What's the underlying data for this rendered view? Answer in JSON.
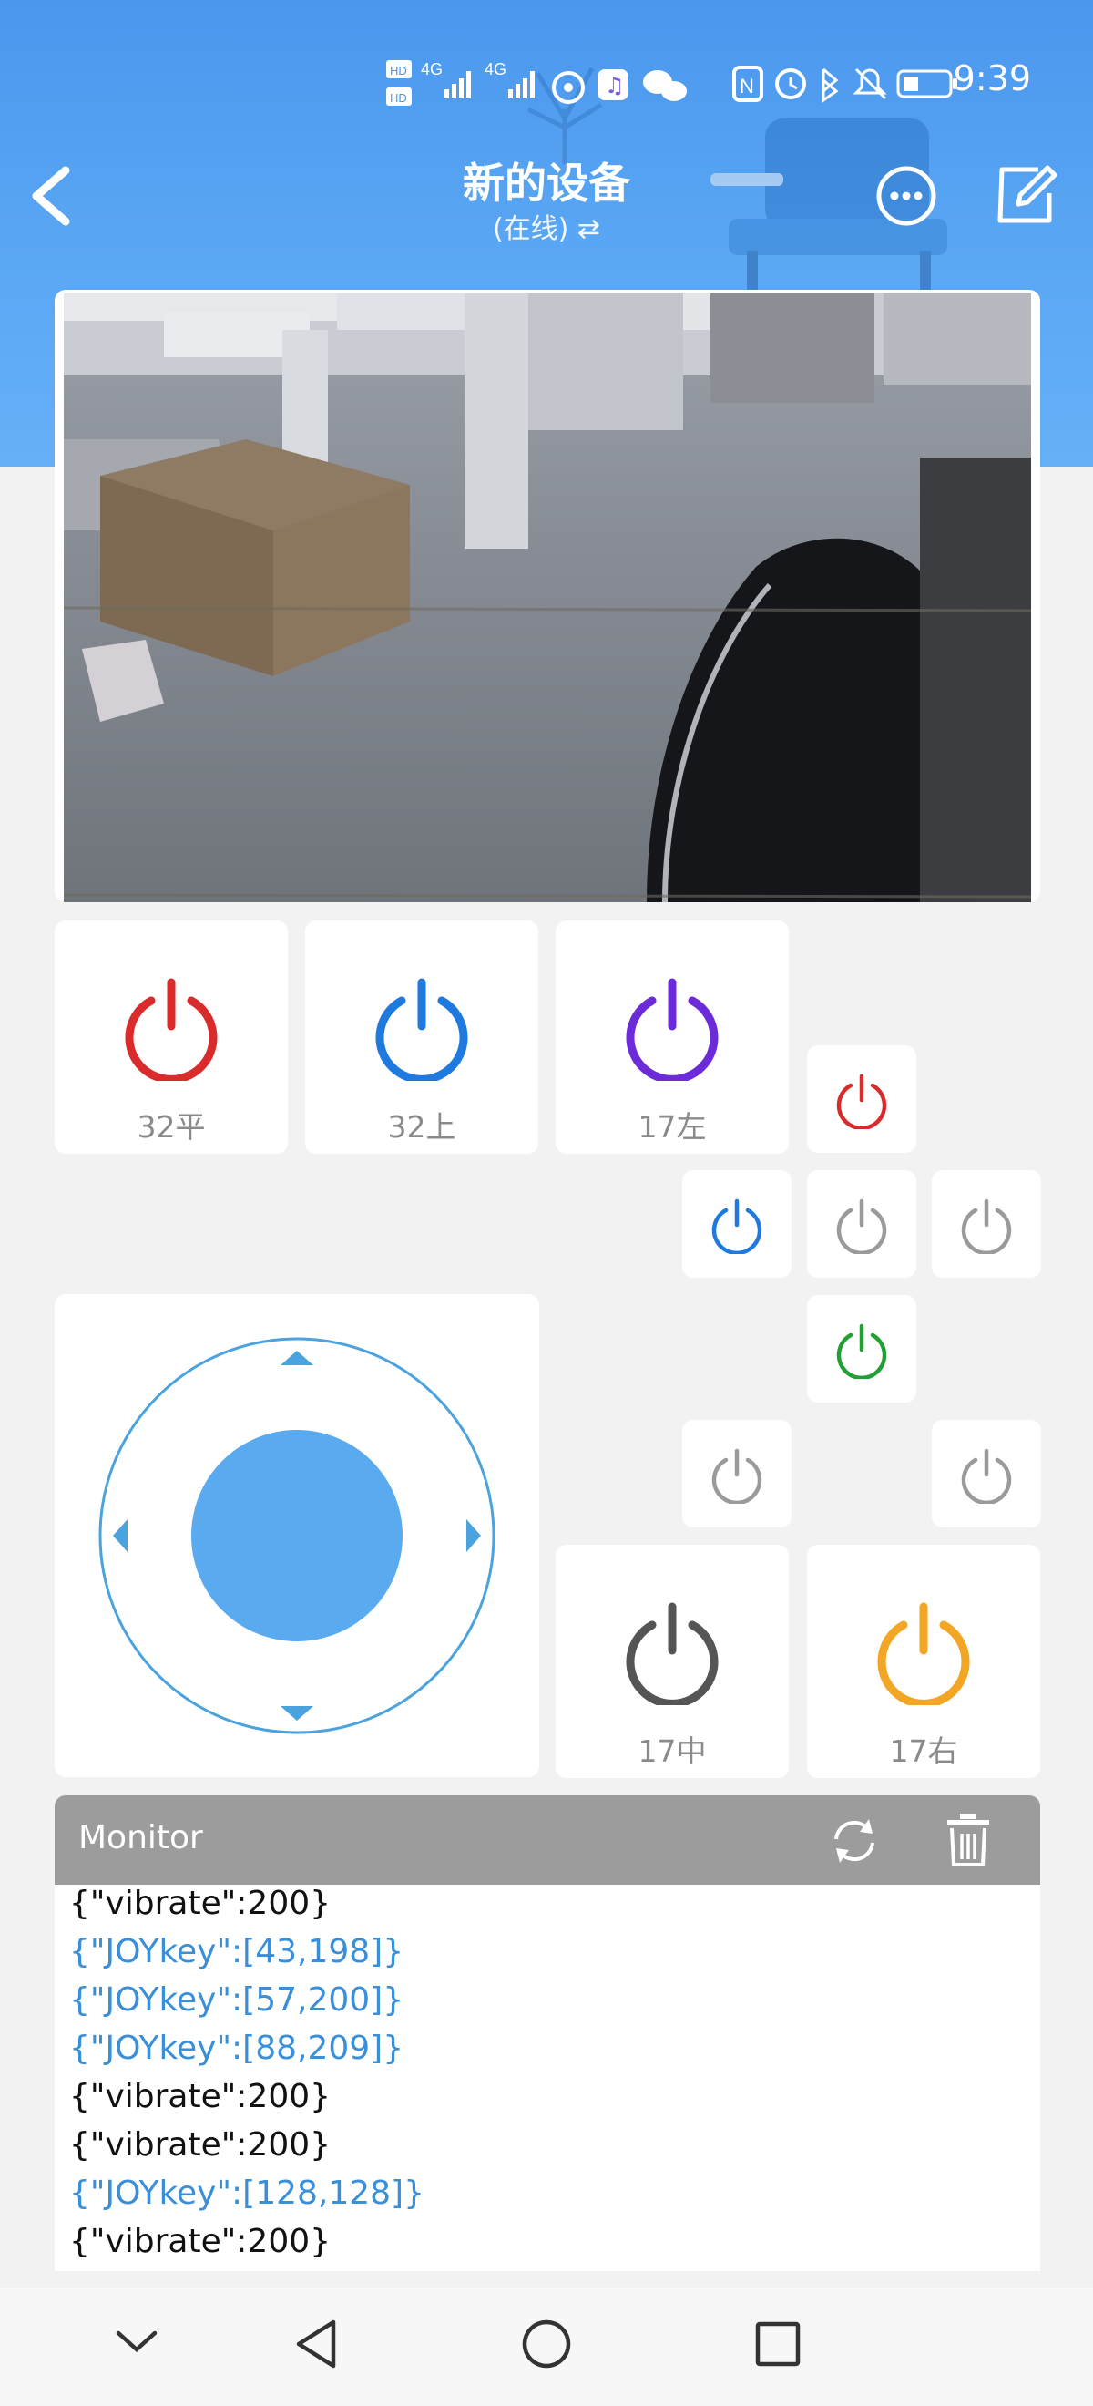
{
  "status_bar": {
    "time": "9:39",
    "network": [
      "4G",
      "4G"
    ],
    "hd_labels": [
      "HD 1",
      "HD 2"
    ],
    "battery_icon": "battery-icon"
  },
  "header": {
    "title": "新的设备",
    "subtitle": "(在线) ⇄"
  },
  "buttons": {
    "b1": {
      "label": "32平",
      "color": "#d92b2b"
    },
    "b2": {
      "label": "32上",
      "color": "#1f7ae0"
    },
    "b3": {
      "label": "17左",
      "color": "#6b2bd9"
    },
    "b4": {
      "label": "17中",
      "color": "#555555"
    },
    "b5": {
      "label": "17右",
      "color": "#f2a623"
    }
  },
  "dpad_colors": {
    "up": "#d92b2b",
    "left": "#1f7ae0",
    "center": "#9a9a9a",
    "right": "#9a9a9a",
    "down": "#23a033",
    "extra_left": "#9a9a9a",
    "extra_right": "#9a9a9a"
  },
  "joystick": {
    "ring_color": "#4aa3df",
    "knob_color": "#5aaaf0"
  },
  "monitor": {
    "title": "Monitor",
    "lines": [
      {
        "text": "{\"vibrate\":200}",
        "color": "#111111"
      },
      {
        "text": "{\"JOYkey\":[43,198]}",
        "color": "#3a8fd8"
      },
      {
        "text": "{\"JOYkey\":[57,200]}",
        "color": "#3a8fd8"
      },
      {
        "text": "{\"JOYkey\":[88,209]}",
        "color": "#3a8fd8"
      },
      {
        "text": "{\"vibrate\":200}",
        "color": "#111111"
      },
      {
        "text": "{\"vibrate\":200}",
        "color": "#111111"
      },
      {
        "text": "{\"JOYkey\":[128,128]}",
        "color": "#3a8fd8"
      },
      {
        "text": "{\"vibrate\":200}",
        "color": "#111111"
      }
    ]
  }
}
